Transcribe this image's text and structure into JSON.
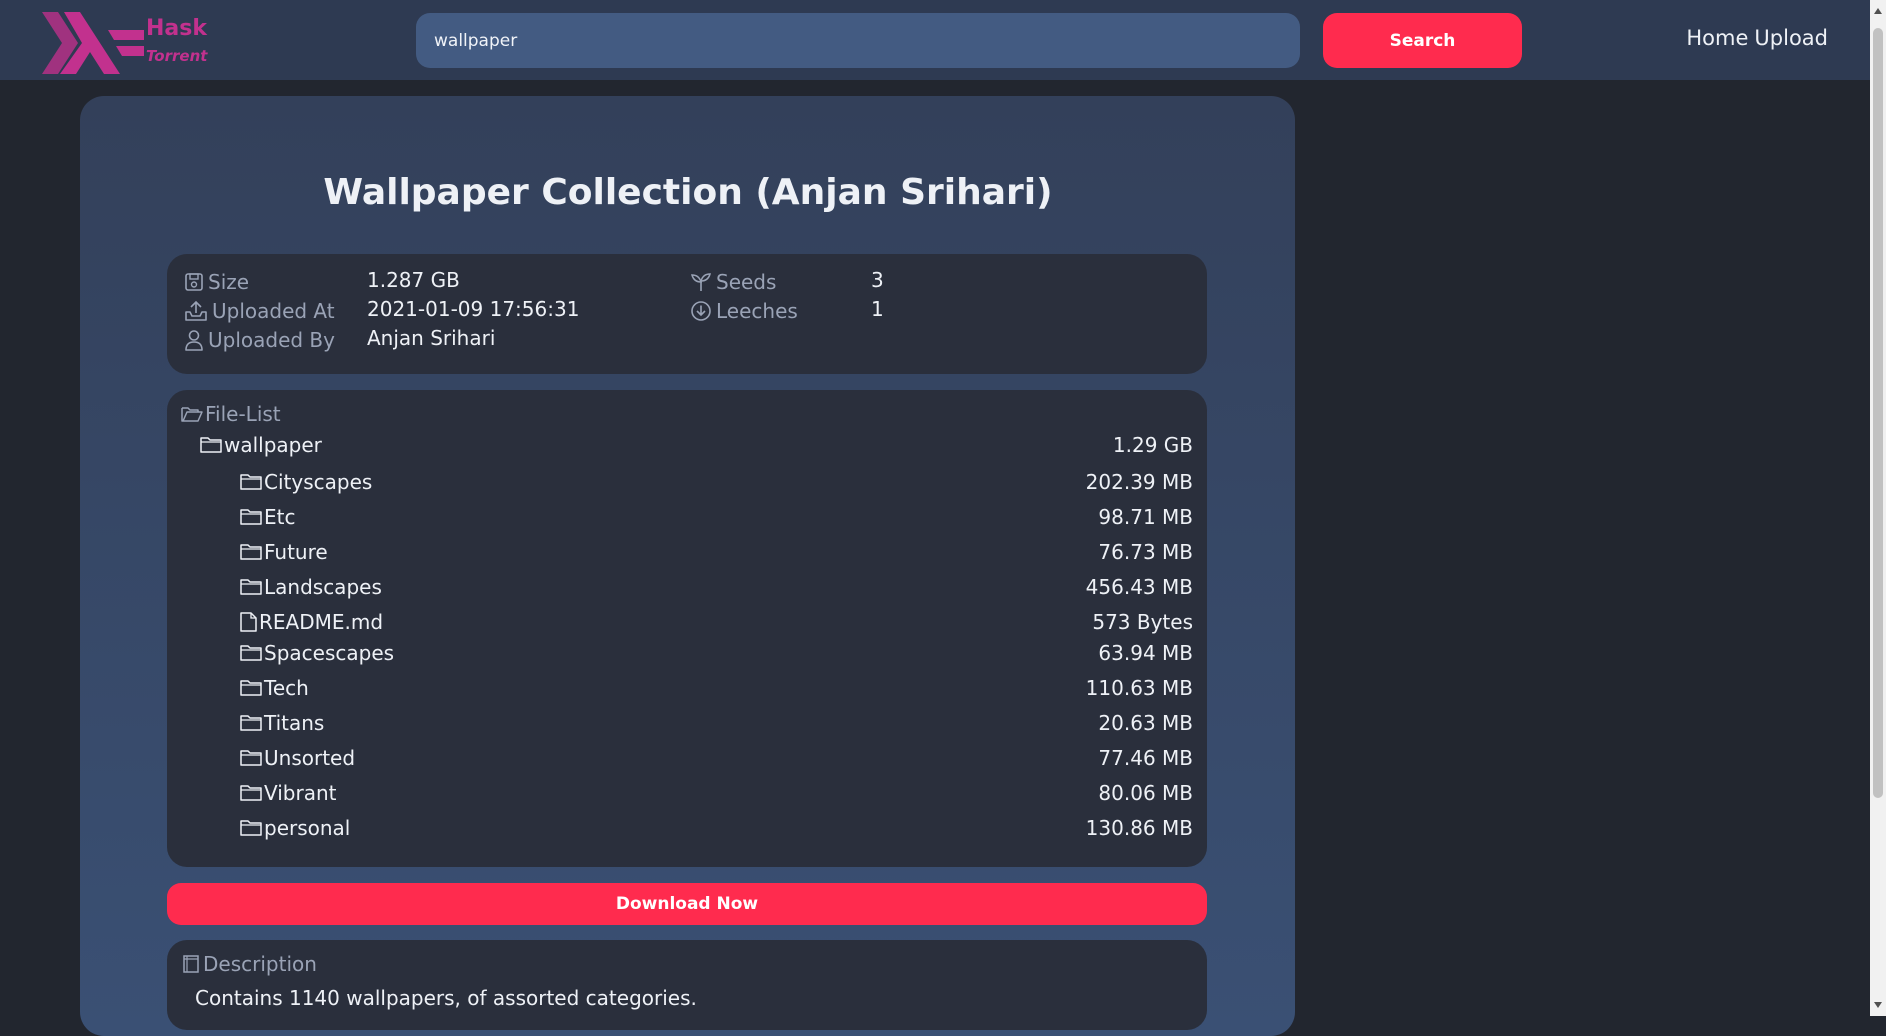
{
  "header": {
    "logo_text_primary": "Hask",
    "logo_text_secondary": "Torrent",
    "search_value": "wallpaper",
    "search_button": "Search",
    "nav": [
      {
        "label": "Home"
      },
      {
        "label": "Upload"
      }
    ]
  },
  "torrent": {
    "title": "Wallpaper Collection (Anjan Srihari)",
    "info": {
      "size_label": "Size",
      "size_value": "1.287 GB",
      "uploaded_at_label": "Uploaded At",
      "uploaded_at_value": "2021-01-09 17:56:31",
      "uploaded_by_label": "Uploaded By",
      "uploaded_by_value": "Anjan Srihari",
      "seeds_label": "Seeds",
      "seeds_value": "3",
      "leeches_label": "Leeches",
      "leeches_value": "1"
    },
    "file_list": {
      "heading": "File-List",
      "root": {
        "name": "wallpaper",
        "size": "1.29 GB",
        "icon": "folder-icon"
      },
      "items": [
        {
          "name": "Cityscapes",
          "size": "202.39 MB",
          "icon": "folder-icon"
        },
        {
          "name": "Etc",
          "size": "98.71 MB",
          "icon": "folder-icon"
        },
        {
          "name": "Future",
          "size": "76.73 MB",
          "icon": "folder-icon"
        },
        {
          "name": "Landscapes",
          "size": "456.43 MB",
          "icon": "folder-icon"
        },
        {
          "name": "README.md",
          "size": "573 Bytes",
          "icon": "file-icon"
        },
        {
          "name": "Spacescapes",
          "size": "63.94 MB",
          "icon": "folder-icon"
        },
        {
          "name": "Tech",
          "size": "110.63 MB",
          "icon": "folder-icon"
        },
        {
          "name": "Titans",
          "size": "20.63 MB",
          "icon": "folder-icon"
        },
        {
          "name": "Unsorted",
          "size": "77.46 MB",
          "icon": "folder-icon"
        },
        {
          "name": "Vibrant",
          "size": "80.06 MB",
          "icon": "folder-icon"
        },
        {
          "name": "personal",
          "size": "130.86 MB",
          "icon": "folder-icon"
        }
      ]
    },
    "download_button": "Download Now",
    "description": {
      "heading": "Description",
      "text": "Contains 1140 wallpapers, of assorted categories."
    }
  },
  "colors": {
    "accent": "#ff2b4e",
    "brand": "#c2318e",
    "topbar": "#2e3a52",
    "panel": "#2a2f3c"
  }
}
